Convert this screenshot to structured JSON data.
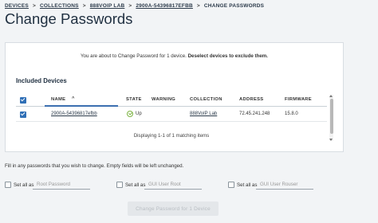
{
  "breadcrumb": {
    "items": [
      "DEVICES",
      "COLLECTIONS",
      "888VOIP LAB",
      "2900A-54396817EFBB",
      "CHANGE PASSWORDS"
    ],
    "separator": ">"
  },
  "page_title": "Change Passwords",
  "info": {
    "text": "You are about to Change Password for 1 device.",
    "bold": "Deselect devices to exclude them."
  },
  "devices_section": {
    "title": "Included Devices",
    "columns": {
      "name": "NAME",
      "sort_indicator": "^",
      "state": "STATE",
      "warning": "WARNING",
      "collection": "COLLECTION",
      "address": "ADDRESS",
      "firmware": "FIRMWARE"
    },
    "rows": [
      {
        "name": "2900A-54396817efbb",
        "state": "Up",
        "warning": "",
        "collection": "888VoIP Lab",
        "address": "72.45.241.248",
        "firmware": "15.8.0"
      }
    ],
    "matching_text": "Displaying 1-1 of 1 matching items"
  },
  "fill_note": "Fill in any passwords that you wish to change. Empty fields will be left unchanged.",
  "password_fields": {
    "set_all_label": "Set all as",
    "root": {
      "placeholder": "Root Password",
      "value": ""
    },
    "gui_root": {
      "placeholder": "GUI User Root",
      "value": ""
    },
    "gui_rouser": {
      "placeholder": "GUI User Rouser",
      "value": ""
    }
  },
  "submit_label": "Change Password for 1 Device",
  "colors": {
    "accent": "#2f6fb6",
    "status_up": "#7cb342",
    "title": "#1f2f40"
  },
  "icons": [
    "checkbox-checked",
    "checkbox-empty",
    "check-circle-icon",
    "sort-up-icon",
    "scroll-up-arrow",
    "scroll-down-arrow"
  ]
}
